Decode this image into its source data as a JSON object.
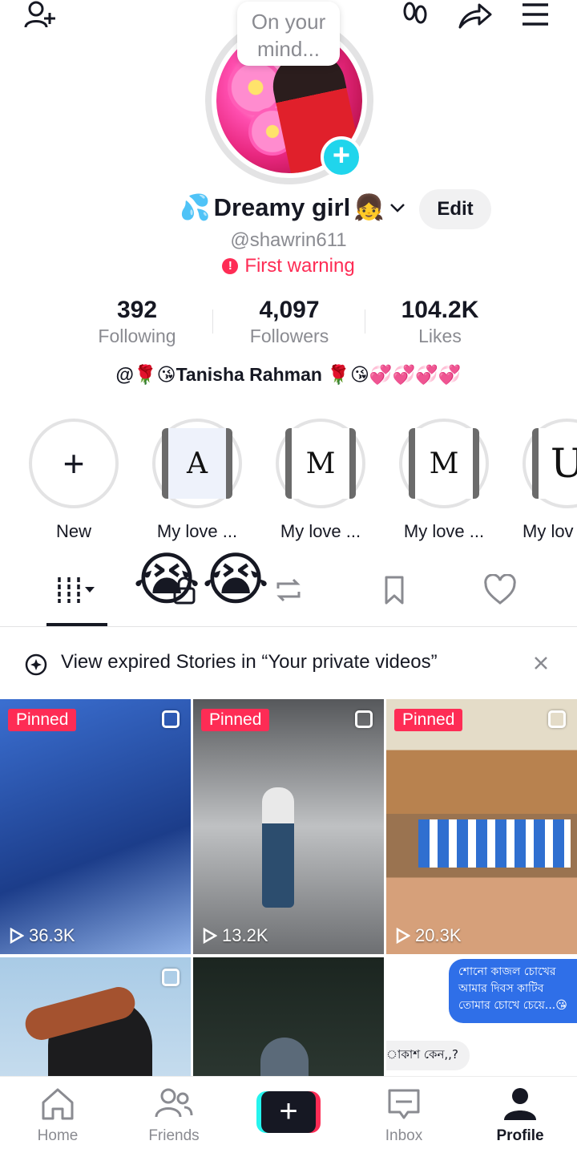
{
  "top_bar": {
    "thought_bubble": "On your mind..."
  },
  "profile": {
    "name_prefix_emoji": "💦",
    "name": "Dreamy girl",
    "name_suffix_emoji": "👧",
    "edit_label": "Edit",
    "handle": "@shawrin611",
    "warning": "First warning",
    "bio": "@🌹😘Tanisha Rahman 🌹😘💞💞💞💞"
  },
  "stats": [
    {
      "value": "392",
      "label": "Following"
    },
    {
      "value": "4,097",
      "label": "Followers"
    },
    {
      "value": "104.2K",
      "label": "Likes"
    }
  ],
  "highlights": [
    {
      "label": "New",
      "letter": "+"
    },
    {
      "label": "My love ...",
      "letter": "A"
    },
    {
      "label": "My love ...",
      "letter": "M"
    },
    {
      "label": "My love ...",
      "letter": "M"
    },
    {
      "label": "My lov",
      "letter": "U"
    }
  ],
  "tabs_overlay_emoji": "😭",
  "banner": {
    "text": "View expired Stories in “Your private videos”"
  },
  "videos": [
    {
      "pinned": "Pinned",
      "views": "36.3K",
      "bg": "#2a4fa8"
    },
    {
      "pinned": "Pinned",
      "views": "13.2K",
      "bg": "#8f9396"
    },
    {
      "pinned": "Pinned",
      "views": "20.3K",
      "bg": "#c9a37e"
    },
    {
      "pinned": "",
      "views": "",
      "bg": "#b9d5ea"
    },
    {
      "pinned": "",
      "views": "",
      "bg": "#23302b"
    },
    {
      "pinned": "",
      "views": "",
      "bg": "#ffffff"
    }
  ],
  "chat_preview": {
    "bubble_text": "শোনো কাজল চোখের\nআমার দিবস কাটিব\nতোমার চোখে চেয়ে...😘",
    "reply_text": "াকাশ কেন,,?"
  },
  "bottom_nav": [
    {
      "label": "Home"
    },
    {
      "label": "Friends"
    },
    {
      "label": ""
    },
    {
      "label": "Inbox"
    },
    {
      "label": "Profile"
    }
  ],
  "colors": {
    "accent_red": "#fe2c55",
    "accent_cyan": "#20d5ec",
    "text_primary": "#161823",
    "text_secondary": "#8a8b91"
  }
}
